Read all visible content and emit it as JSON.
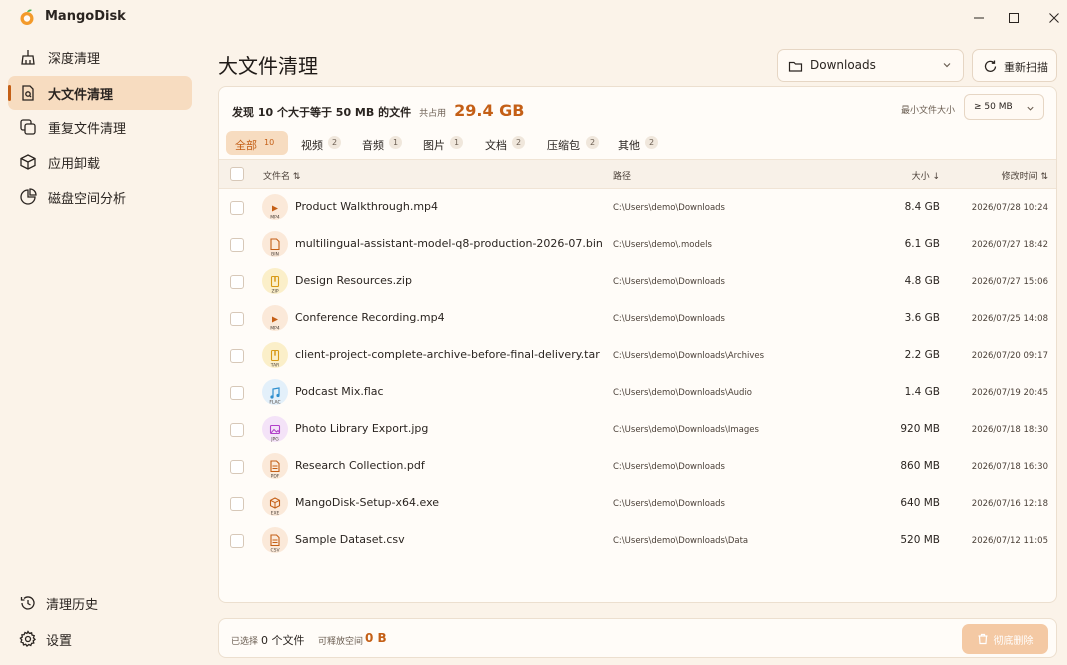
{
  "app": {
    "title": "MangoDisk"
  },
  "sidebar": {
    "items": [
      {
        "label": "深度清理",
        "icon": "broom-icon"
      },
      {
        "label": "大文件清理",
        "icon": "file-search-icon",
        "active": true
      },
      {
        "label": "重复文件清理",
        "icon": "copy-icon"
      },
      {
        "label": "应用卸载",
        "icon": "package-icon"
      },
      {
        "label": "磁盘空间分析",
        "icon": "pie-chart-icon"
      }
    ],
    "bottom": [
      {
        "label": "清理历史",
        "icon": "history-icon"
      },
      {
        "label": "设置",
        "icon": "gear-icon"
      }
    ]
  },
  "header": {
    "title": "大文件清理",
    "folder_select": "Downloads",
    "rescan_label": "重新扫描"
  },
  "summary": {
    "text": "发现 10 个大于等于 50 MB 的文件",
    "occupy_label": "共占用",
    "total": "29.4 GB",
    "min_size_label": "最小文件大小",
    "min_size_value": "≥ 50 MB"
  },
  "tabs": [
    {
      "label": "全部",
      "count": "10",
      "active": true
    },
    {
      "label": "视频",
      "count": "2"
    },
    {
      "label": "音频",
      "count": "1"
    },
    {
      "label": "图片",
      "count": "1"
    },
    {
      "label": "文档",
      "count": "2"
    },
    {
      "label": "压缩包",
      "count": "2"
    },
    {
      "label": "其他",
      "count": "2"
    }
  ],
  "table": {
    "headers": {
      "name": "文件名 ⇅",
      "path": "路径",
      "size": "大小 ↓",
      "modified": "修改时间 ⇅"
    },
    "rows": [
      {
        "name": "Product Walkthrough.mp4",
        "ext": "MP4",
        "path": "C:\\Users\\demo\\Downloads",
        "size": "8.4 GB",
        "modified": "2026/07/28 10:24",
        "kind": "video",
        "color": "#c45f16"
      },
      {
        "name": "multilingual-assistant-model-q8-production-2026-07.bin",
        "ext": "BIN",
        "path": "C:\\Users\\demo\\.models",
        "size": "6.1 GB",
        "modified": "2026/07/27 18:42",
        "kind": "file",
        "color": "#c45f16"
      },
      {
        "name": "Design Resources.zip",
        "ext": "ZIP",
        "path": "C:\\Users\\demo\\Downloads",
        "size": "4.8 GB",
        "modified": "2026/07/27 15:06",
        "kind": "archive",
        "color": "#d89a17"
      },
      {
        "name": "Conference Recording.mp4",
        "ext": "MP4",
        "path": "C:\\Users\\demo\\Downloads",
        "size": "3.6 GB",
        "modified": "2026/07/25 14:08",
        "kind": "video",
        "color": "#c45f16"
      },
      {
        "name": "client-project-complete-archive-before-final-delivery.tar",
        "ext": "TAR",
        "path": "C:\\Users\\demo\\Downloads\\Archives",
        "size": "2.2 GB",
        "modified": "2026/07/20 09:17",
        "kind": "archive",
        "color": "#d89a17"
      },
      {
        "name": "Podcast Mix.flac",
        "ext": "FLAC",
        "path": "C:\\Users\\demo\\Downloads\\Audio",
        "size": "1.4 GB",
        "modified": "2026/07/19 20:45",
        "kind": "audio",
        "color": "#2f8fcf"
      },
      {
        "name": "Photo Library Export.jpg",
        "ext": "JPG",
        "path": "C:\\Users\\demo\\Downloads\\Images",
        "size": "920 MB",
        "modified": "2026/07/18 18:30",
        "kind": "image",
        "color": "#b13fc9"
      },
      {
        "name": "Research Collection.pdf",
        "ext": "PDF",
        "path": "C:\\Users\\demo\\Downloads",
        "size": "860 MB",
        "modified": "2026/07/18 16:30",
        "kind": "document",
        "color": "#c45f16"
      },
      {
        "name": "MangoDisk-Setup-x64.exe",
        "ext": "EXE",
        "path": "C:\\Users\\demo\\Downloads",
        "size": "640 MB",
        "modified": "2026/07/16 12:18",
        "kind": "package",
        "color": "#c45f16"
      },
      {
        "name": "Sample Dataset.csv",
        "ext": "CSV",
        "path": "C:\\Users\\demo\\Downloads\\Data",
        "size": "520 MB",
        "modified": "2026/07/12 11:05",
        "kind": "document",
        "color": "#c45f16"
      }
    ]
  },
  "footer": {
    "selected_label": "已选择",
    "selected_value": "0 个文件",
    "free_label": "可释放空间",
    "free_value": "0 B",
    "delete_label": "彻底删除"
  },
  "colors": {
    "accent": "#c45f16",
    "background": "#fbf3e9",
    "active_bg": "#f7dcc0"
  }
}
